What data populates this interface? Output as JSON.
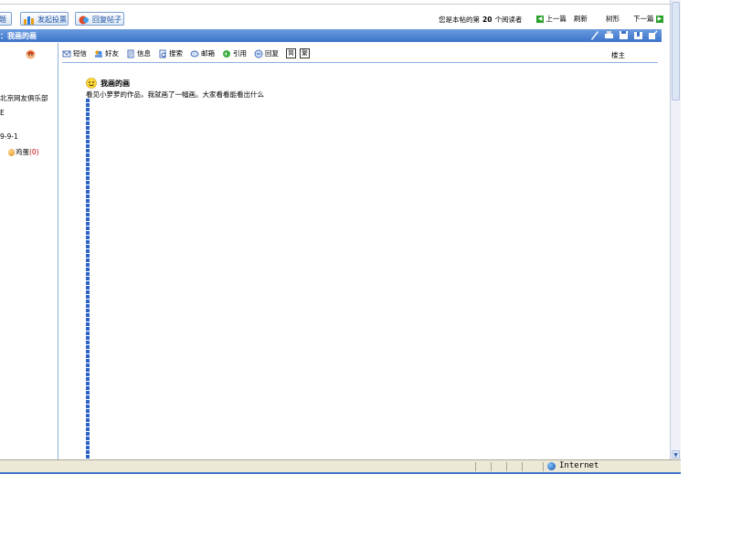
{
  "toolbar": {
    "btn_new_topic": "题",
    "btn_new_poll": "发起投票",
    "btn_reply": "回复帖子",
    "reader_prefix": "您是本帖的第",
    "reader_count": "20",
    "reader_suffix": "个阅读者",
    "prev": "上一篇",
    "refresh": "刷新",
    "tree": "树形",
    "next": "下一篇"
  },
  "title_bar": {
    "title": "：我画的画"
  },
  "user_panel": {
    "club": "北京网友俱乐部",
    "line2": "E",
    "date": "9-9-1",
    "egg_label": "鸡蛋",
    "egg_count": "(0)"
  },
  "post": {
    "actions": [
      "短信",
      "好友",
      "信息",
      "搜索",
      "邮箱",
      "引用",
      "回复"
    ],
    "box_simplified": "简",
    "box_traditional": "繁",
    "floor": "楼主",
    "title": "我画的画",
    "body": "看见小萝萝的作品，我就画了一幅画。大家看看能看出什么"
  },
  "status": {
    "zone": "Internet"
  },
  "colors": {
    "accent": "#3d74c9",
    "link": "#1a4fa0",
    "border": "#8fb0e0"
  }
}
